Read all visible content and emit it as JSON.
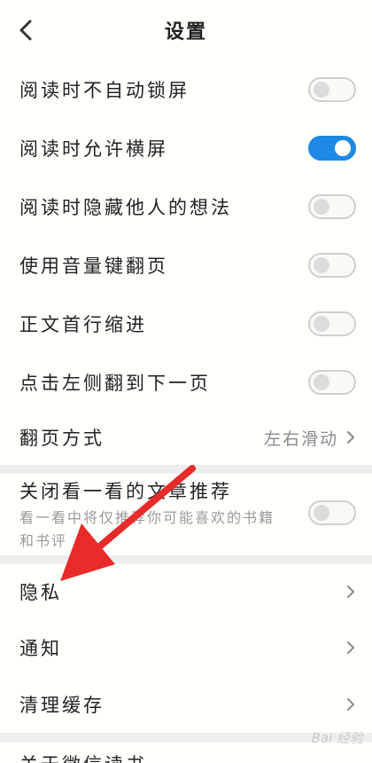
{
  "header": {
    "title": "设置"
  },
  "settings": [
    {
      "label": "阅读时不自动锁屏",
      "on": false
    },
    {
      "label": "阅读时允许横屏",
      "on": true
    },
    {
      "label": "阅读时隐藏他人的想法",
      "on": false
    },
    {
      "label": "使用音量键翻页",
      "on": false
    },
    {
      "label": "正文首行缩进",
      "on": false
    },
    {
      "label": "点击左侧翻到下一页",
      "on": false
    }
  ],
  "page_turn": {
    "label": "翻页方式",
    "value": "左右滑动"
  },
  "recommend": {
    "label": "关闭看一看的文章推荐",
    "description_line1": "看一看中将仅推荐你可能喜欢的书籍",
    "description_line2": "和书评",
    "on": false
  },
  "nav_items": [
    {
      "label": "隐私"
    },
    {
      "label": "通知"
    },
    {
      "label": "清理缓存"
    }
  ],
  "partial_item": {
    "label": "关于微信读书"
  },
  "watermark": {
    "text": "Bai 经验"
  },
  "colors": {
    "accent": "#1e88e5",
    "annotation_arrow": "#e82a2a"
  }
}
